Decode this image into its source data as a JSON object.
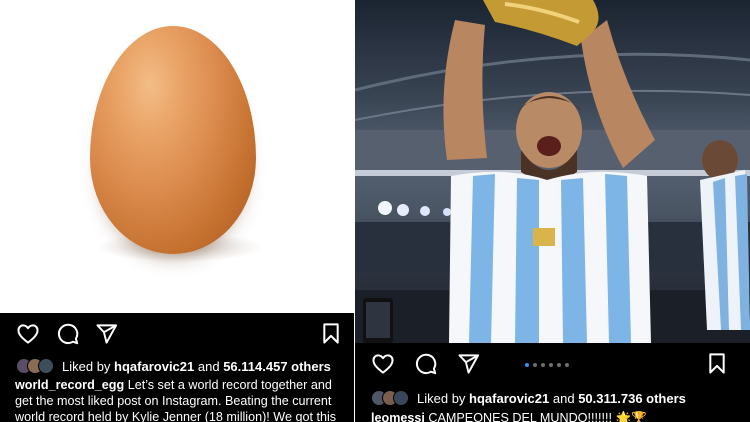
{
  "left_post": {
    "likes_prefix": "Liked by",
    "likes_user": "hqafarovic21",
    "likes_and": "and",
    "likes_count": "56.114.457 others",
    "caption_user": "world_record_egg",
    "caption_text": "Let’s set a world record together and get the most liked post on Instagram. Beating the current world record held by Kylie Jenner (18 million)! We got this 🙌"
  },
  "right_post": {
    "likes_prefix": "Liked by",
    "likes_user": "hqafarovic21",
    "likes_and": "and",
    "likes_count": "50.311.736 others",
    "caption_user": "leomessi",
    "caption_text": "CAMPEONES DEL MUNDO!!!!!!! 🌟🏆",
    "carousel_pages": 6,
    "carousel_active": 1
  },
  "icons": [
    "heart-icon",
    "comment-icon",
    "share-icon",
    "bookmark-icon"
  ],
  "colors": {
    "background": "#000000",
    "text": "#ffffff",
    "carousel_active": "#3b8ef0",
    "carousel_inactive": "#6d6d6d",
    "egg": "#d9884a"
  }
}
